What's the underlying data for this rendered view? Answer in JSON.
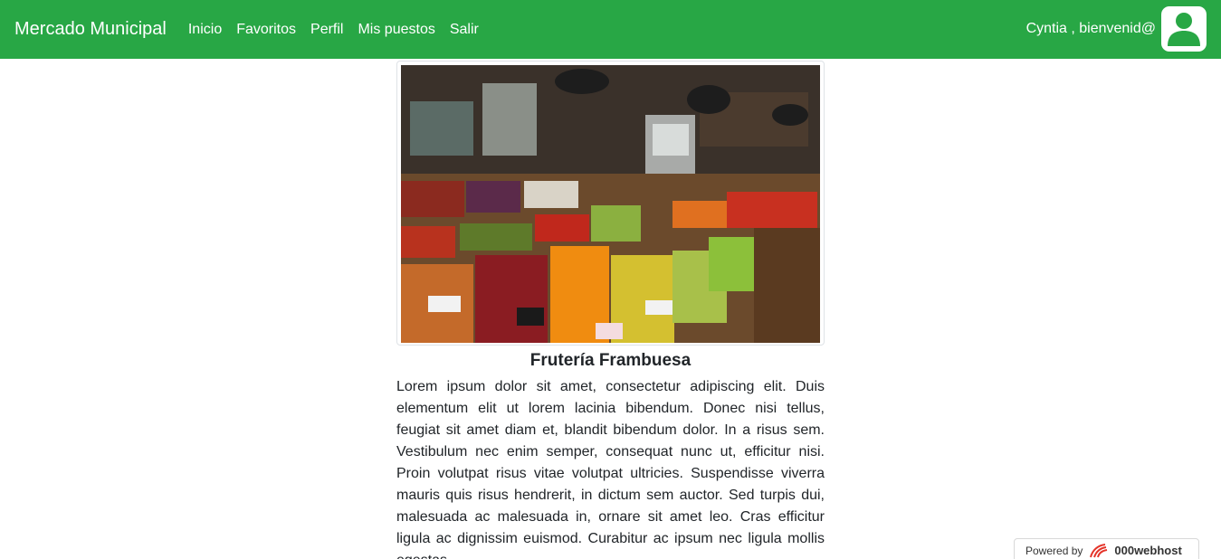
{
  "navbar": {
    "brand": "Mercado Municipal",
    "links": [
      "Inicio",
      "Favoritos",
      "Perfil",
      "Mis puestos",
      "Salir"
    ],
    "greeting": "Cyntia , bienvenid@",
    "avatar_icon": "user-avatar-icon",
    "color": "#28a745"
  },
  "shop": {
    "image_alt": "fruit-market-stall-photo",
    "name": "Frutería Frambuesa",
    "description": "Lorem ipsum dolor sit amet, consectetur adipiscing elit. Duis elementum elit ut lorem lacinia bibendum. Donec nisi tellus, feugiat sit amet diam et, blandit bibendum dolor. In a risus sem. Vestibulum nec enim semper, consequat nunc ut, efficitur nisi. Proin volutpat risus vitae volutpat ultricies. Suspendisse viverra mauris quis risus hendrerit, in dictum sem auctor. Sed turpis dui, malesuada ac malesuada in, ornare sit amet leo. Cras efficitur ligula ac dignissim euismod. Curabitur ac ipsum nec ligula mollis egestas."
  },
  "footer_badge": {
    "prefix": "Powered by",
    "brand": "000webhost",
    "logo_icon": "000webhost-logo-icon"
  }
}
